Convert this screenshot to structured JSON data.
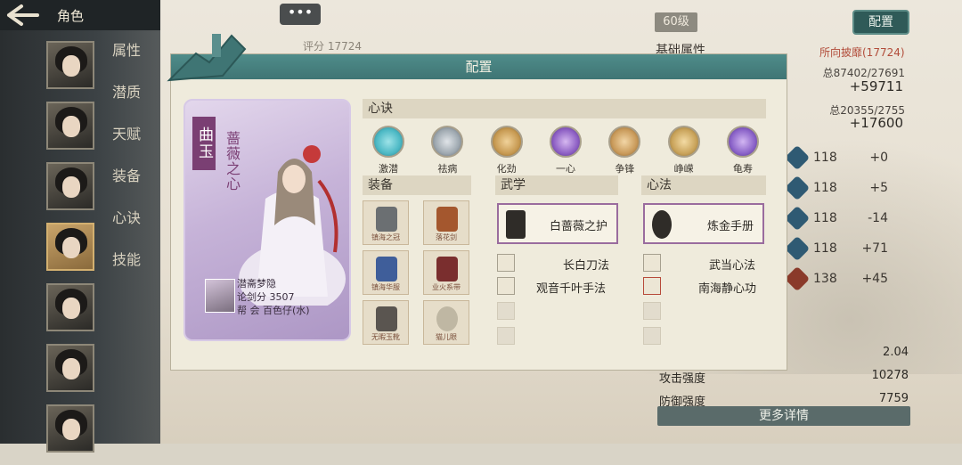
{
  "topbar": {
    "back_icon": "arrow-left-icon",
    "title": "角色"
  },
  "side_tabs": [
    "属性",
    "潜质",
    "天赋",
    "装备",
    "心诀",
    "技能"
  ],
  "portraits_count": 7,
  "top_right": {
    "level": "60级",
    "config_button": "配置",
    "base_attr_label": "基础属性",
    "power_note": "所向披靡(17724)",
    "stat1": "总87402/27691",
    "stat1_delta": "+59711",
    "stat2": "总20355/2755",
    "stat2_delta": "+17600"
  },
  "right_rows": [
    {
      "icon": "blue",
      "value": "118",
      "delta": "+0"
    },
    {
      "icon": "blue",
      "value": "118",
      "delta": "+5"
    },
    {
      "icon": "blue",
      "value": "118",
      "delta": "-14"
    },
    {
      "icon": "blue",
      "value": "118",
      "delta": "+71"
    },
    {
      "icon": "red",
      "value": "138",
      "delta": "+45"
    }
  ],
  "bottom_stats": [
    {
      "label": "",
      "value": "2.04"
    },
    {
      "label": "攻击强度",
      "value": "10278"
    },
    {
      "label": "防御强度",
      "value": "7759"
    }
  ],
  "more_details": "更多详情",
  "chat_button": "•••",
  "score": "评分 17724",
  "modal": {
    "title": "配置",
    "card": {
      "name": "曲玉",
      "title": "蔷薇之心",
      "player": "潜斋梦隐",
      "score": "论剑分 3507",
      "guild": "帮  会 百色仔(水)"
    },
    "xinjue_header": "心诀",
    "skills": [
      {
        "name": "激潜",
        "color": "#4bb8c4"
      },
      {
        "name": "祛病",
        "color": "#9ea8b0"
      },
      {
        "name": "化劲",
        "color": "#c79a52"
      },
      {
        "name": "一心",
        "color": "#8d5fc4"
      },
      {
        "name": "争锋",
        "color": "#c99a5a"
      },
      {
        "name": "峥嵘",
        "color": "#c9a35a"
      },
      {
        "name": "龟寿",
        "color": "#8a62c8"
      }
    ],
    "equip_header": "装备",
    "equips": [
      {
        "label": "镇海之冠",
        "color": "#6b6f72"
      },
      {
        "label": "落花剑",
        "color": "#a4572e"
      },
      {
        "label": "镇海华服",
        "color": "#3f5e9a"
      },
      {
        "label": "业火系带",
        "color": "#7a2e2e"
      },
      {
        "label": "无暇玉靴",
        "color": "#5a5550"
      },
      {
        "label": "猫儿眼",
        "color": "#bfb7a3"
      }
    ],
    "martial_header": "武学",
    "martial_main": "白蔷薇之护",
    "martial_items": [
      "长白刀法",
      "观音千叶手法"
    ],
    "xinfa_header": "心法",
    "xinfa_main": "炼金手册",
    "xinfa_items": [
      "武当心法",
      "南海静心功"
    ]
  }
}
